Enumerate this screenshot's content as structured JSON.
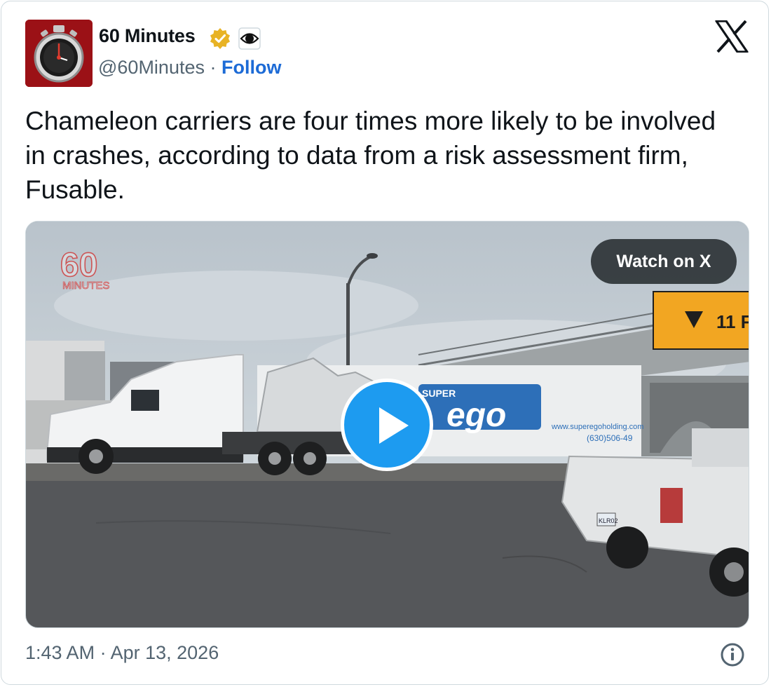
{
  "author": {
    "name": "60 Minutes",
    "handle": "@60Minutes",
    "separator": "·",
    "follow_label": "Follow",
    "avatar_icon": "stopwatch-icon",
    "badges": [
      "verified-gold-badge-icon",
      "cbs-eye-icon"
    ]
  },
  "platform_icon": "x-logo-icon",
  "tweet": {
    "text": "Chameleon carriers are four times more likely to be involved in crashes, according to data from a risk assessment firm, Fusable."
  },
  "media": {
    "watch_label": "Watch on X",
    "watermark": {
      "top": "60",
      "bottom": "MINUTES"
    },
    "sign_text": "11 F",
    "trailer_brand": "ego",
    "trailer_brand_prefix": "SUPER",
    "trailer_url": "www.superegoholding.com",
    "trailer_phone": "(630)506-49",
    "plate": "KLR02",
    "play_icon": "play-icon"
  },
  "footer": {
    "time": "1:43 AM",
    "separator": "·",
    "date": "Apr 13, 2026",
    "info_icon": "info-icon"
  },
  "colors": {
    "follow": "#1d6bd6",
    "play": "#1d9bf0",
    "secondary_text": "#536471",
    "verified": "#e8b325",
    "avatar_bg": "#9b1116"
  }
}
